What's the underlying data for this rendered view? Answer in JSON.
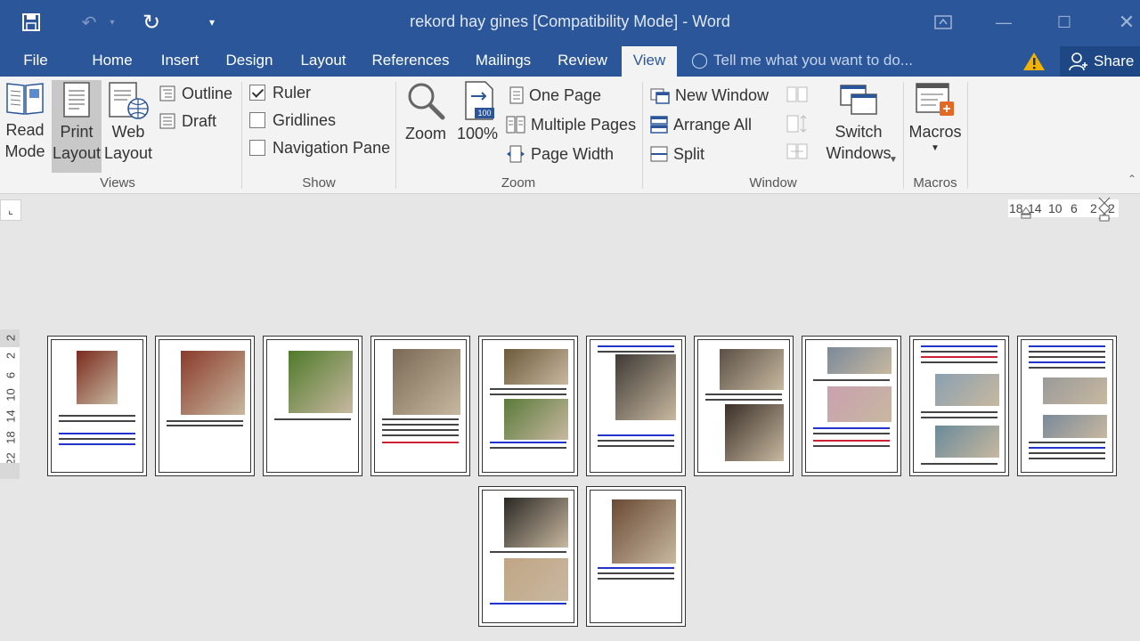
{
  "window": {
    "title": "rekord hay gines [Compatibility Mode] - Word"
  },
  "tabs": [
    {
      "label": "File"
    },
    {
      "label": "Home"
    },
    {
      "label": "Insert"
    },
    {
      "label": "Design"
    },
    {
      "label": "Layout"
    },
    {
      "label": "References"
    },
    {
      "label": "Mailings"
    },
    {
      "label": "Review"
    },
    {
      "label": "View"
    }
  ],
  "tell_me": "Tell me what you want to do...",
  "share_label": "Share",
  "ribbon": {
    "views": {
      "read_mode": "Read\nMode",
      "print_layout": "Print\nLayout",
      "web_layout": "Web\nLayout",
      "outline": "Outline",
      "draft": "Draft",
      "label": "Views"
    },
    "show": {
      "ruler": "Ruler",
      "gridlines": "Gridlines",
      "navigation_pane": "Navigation Pane",
      "ruler_checked": true,
      "gridlines_checked": false,
      "navigation_checked": false,
      "label": "Show"
    },
    "zoom": {
      "zoom": "Zoom",
      "hundred": "100%",
      "one_page": "One Page",
      "multiple_pages": "Multiple Pages",
      "page_width": "Page Width",
      "label": "Zoom"
    },
    "window": {
      "new_window": "New Window",
      "arrange_all": "Arrange All",
      "split": "Split",
      "switch_windows": "Switch\nWindows",
      "label": "Window"
    },
    "macros": {
      "macros": "Macros",
      "label": "Macros"
    }
  },
  "ruler": {
    "horizontal": [
      "18",
      "14",
      "10",
      "6",
      "2",
      "2"
    ],
    "vertical": [
      "2",
      "2",
      "6",
      "10",
      "14",
      "18",
      "22"
    ]
  },
  "colors": {
    "brand": "#2b579a",
    "ribbon_bg": "#f3f3f3",
    "canvas_bg": "#e6e6e6"
  }
}
